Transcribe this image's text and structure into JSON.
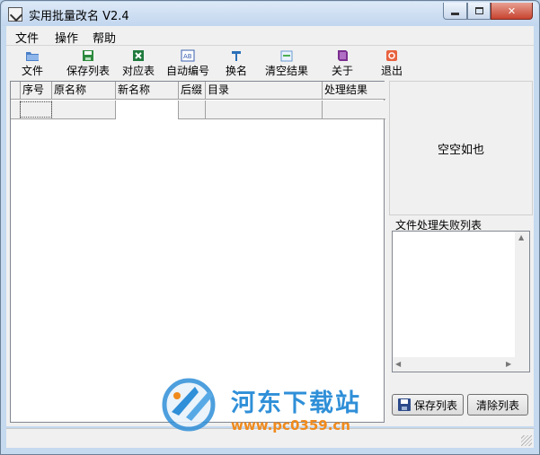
{
  "window": {
    "title": "实用批量改名 V2.4"
  },
  "menu": [
    "文件",
    "操作",
    "帮助"
  ],
  "toolbar": [
    {
      "label": "文件",
      "icon": "folder-icon"
    },
    {
      "label": "保存列表",
      "icon": "save-icon"
    },
    {
      "label": "对应表",
      "icon": "excel-icon"
    },
    {
      "label": "自动编号",
      "icon": "numbering-icon"
    },
    {
      "label": "换名",
      "icon": "rename-icon"
    },
    {
      "label": "清空结果",
      "icon": "clear-icon"
    },
    {
      "label": "关于",
      "icon": "book-icon"
    },
    {
      "label": "退出",
      "icon": "exit-icon"
    }
  ],
  "grid": {
    "columns": [
      "序号",
      "原名称",
      "新名称",
      "后缀",
      "目录",
      "处理结果"
    ]
  },
  "status_panel": {
    "text": "空空如也"
  },
  "failure_list": {
    "title": "文件处理失败列表"
  },
  "buttons": {
    "save_list": "保存列表",
    "clear_list": "清除列表"
  },
  "watermark": {
    "title": "河东下载站",
    "url": "www.pc0359.cn"
  },
  "colors": {
    "accent_blue": "#2f8fd8",
    "accent_orange": "#f08a1c",
    "close_red": "#c7432f"
  }
}
